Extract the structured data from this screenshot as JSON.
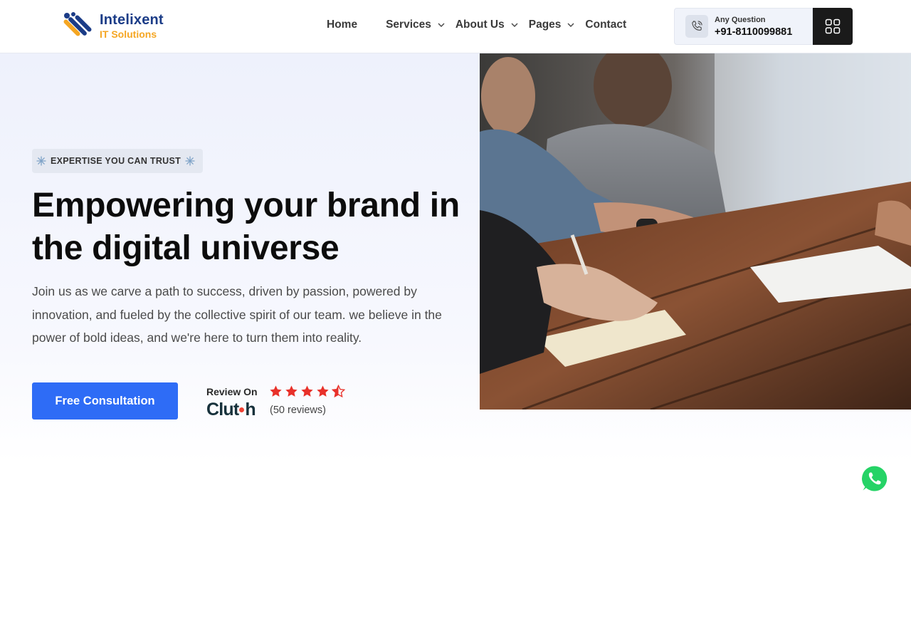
{
  "brand": {
    "name": "Intelixent",
    "tagline": "IT Solutions",
    "colors": {
      "primary": "#1b3c87",
      "accent": "#f5a623",
      "cta": "#2e6cf6",
      "star": "#e8312a",
      "whatsapp": "#25d366"
    }
  },
  "nav": {
    "items": [
      {
        "label": "Home",
        "has_dropdown": false
      },
      {
        "label": "Services",
        "has_dropdown": true
      },
      {
        "label": "About Us",
        "has_dropdown": true
      },
      {
        "label": "Pages",
        "has_dropdown": true
      },
      {
        "label": "Contact",
        "has_dropdown": false
      }
    ]
  },
  "contact": {
    "label": "Any Question",
    "phone": "+91-8110099881",
    "icon": "phone-icon"
  },
  "menu_button": {
    "icon": "grid-icon"
  },
  "hero": {
    "badge": "EXPERTISE YOU CAN TRUST",
    "title": "Empowering your brand in the digital universe",
    "description": "Join us as we carve a path to success, driven by passion, powered by innovation, and fueled by the collective spirit of our team. we believe in the power of bold ideas, and we're here to turn them into reality.",
    "cta_label": "Free Consultation"
  },
  "review": {
    "label": "Review On",
    "platform": "Clutch",
    "rating": 4.5,
    "max_rating": 5,
    "count_text": "(50 reviews)"
  },
  "floating": {
    "icon": "whatsapp-icon"
  }
}
